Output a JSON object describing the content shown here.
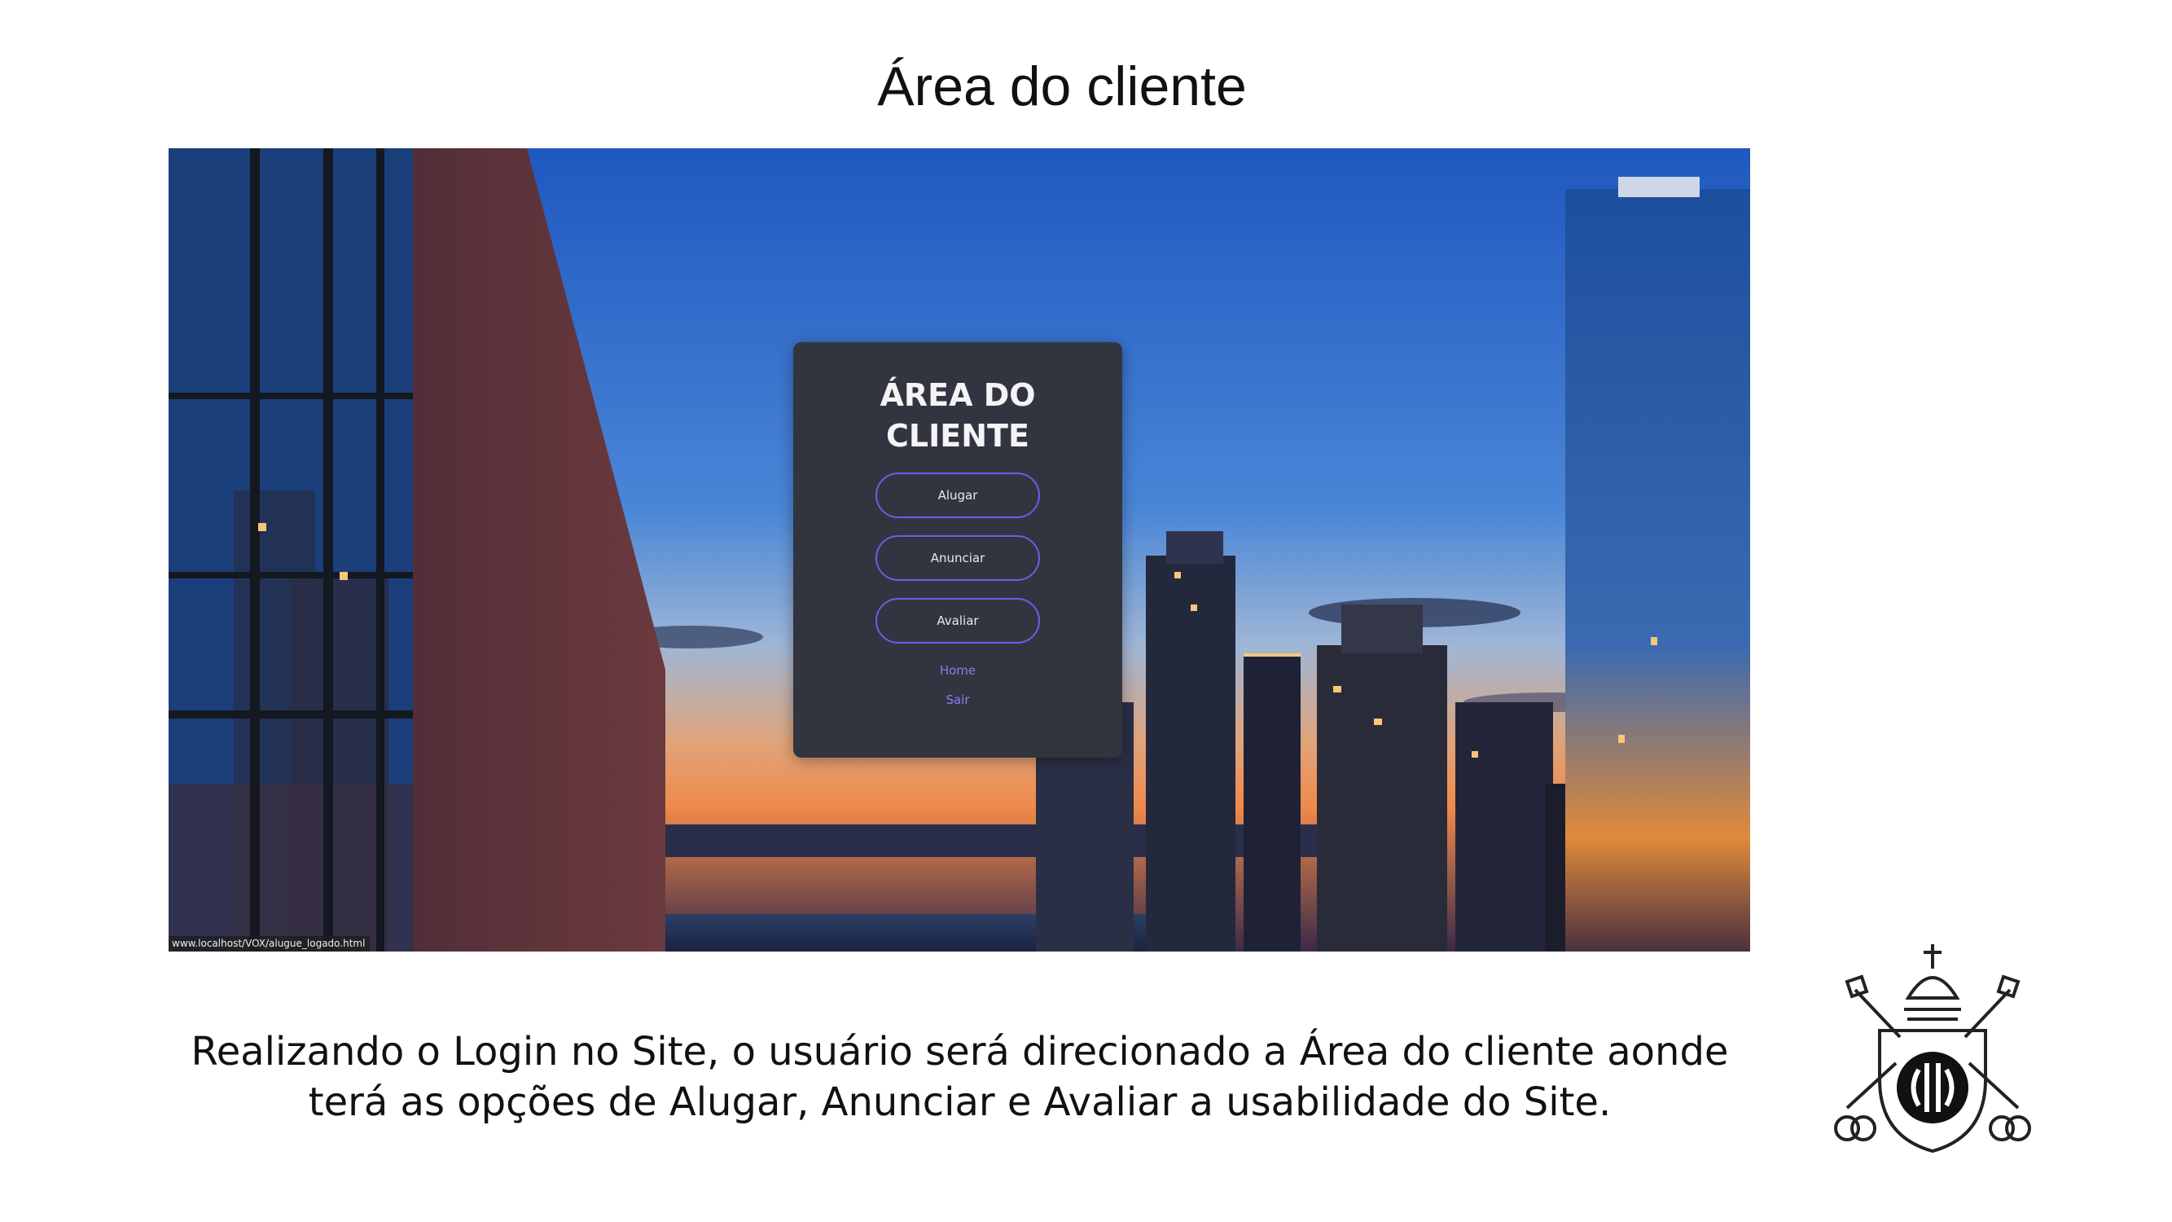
{
  "slide": {
    "title": "Área do cliente",
    "caption": "Realizando o Login no Site, o usuário será direcionado a Área do cliente aonde terá as opções de Alugar, Anunciar e Avaliar a usabilidade do Site."
  },
  "screenshot": {
    "status_url": "www.localhost/VOX/alugue_logado.html",
    "card": {
      "title": "ÁREA DO CLIENTE",
      "buttons": [
        "Alugar",
        "Anunciar",
        "Avaliar"
      ],
      "links": [
        "Home",
        "Sair"
      ]
    }
  },
  "colors": {
    "card_background": "#32353f",
    "button_border": "#6c5ce7",
    "link": "#8c7cf0"
  },
  "icons": {
    "crest": "university-crest-icon"
  }
}
